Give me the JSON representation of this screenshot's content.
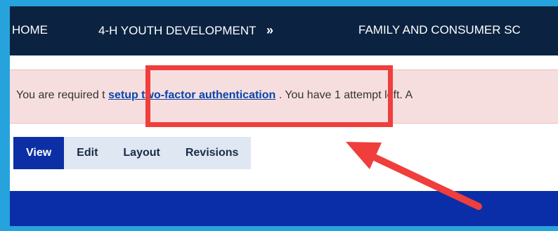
{
  "nav": {
    "home": "HOME",
    "youth": "4-H YOUTH DEVELOPMENT",
    "youth_chevron": "»",
    "family": "FAMILY AND CONSUMER SC"
  },
  "alert": {
    "prefix": "You are required t",
    "link": "setup two-factor authentication",
    "suffix": ". You have 1 attempt left. A"
  },
  "tabs": [
    {
      "label": "View",
      "active": true
    },
    {
      "label": "Edit",
      "active": false
    },
    {
      "label": "Layout",
      "active": false
    },
    {
      "label": "Revisions",
      "active": false
    }
  ],
  "colors": {
    "nav_bg": "#0b2341",
    "alert_bg": "#f7dede",
    "highlight": "#ef3e3b",
    "active_tab": "#0c2fa6",
    "tab_bg": "#dfe7f2",
    "frame": "#26a3dc"
  },
  "annotations": {
    "arrow_icon": "red-arrow-icon",
    "highlight_icon": "red-rectangle-highlight"
  }
}
